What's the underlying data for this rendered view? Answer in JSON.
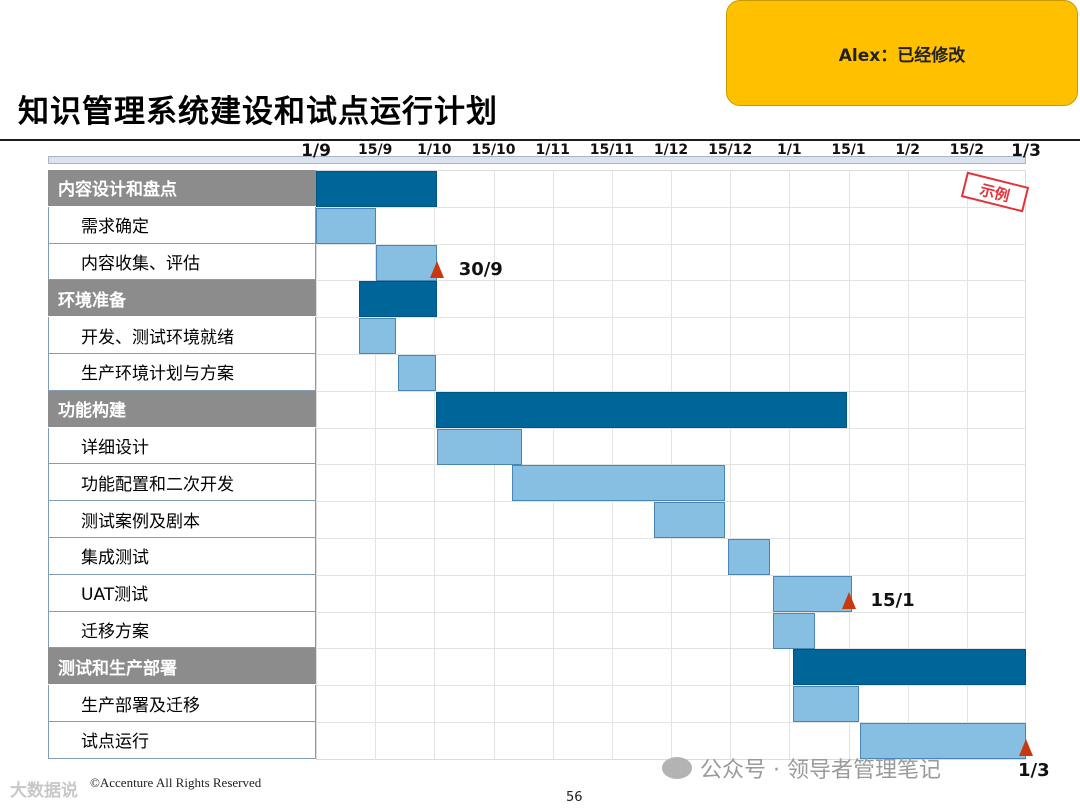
{
  "note": {
    "text": "Alex：已经修改"
  },
  "title": "知识管理系统建设和试点运行计划",
  "timeline": {
    "ticks": [
      "1/9",
      "15/9",
      "1/10",
      "15/10",
      "1/11",
      "15/11",
      "1/12",
      "15/12",
      "1/1",
      "15/1",
      "1/2",
      "15/2",
      "1/3"
    ]
  },
  "rows": [
    {
      "label": "内容设计和盘点",
      "kind": "group",
      "start": 0,
      "end": 1.02
    },
    {
      "label": "需求确定",
      "kind": "task",
      "start": 0,
      "end": 0.51
    },
    {
      "label": "内容收集、评估",
      "kind": "task",
      "start": 0.51,
      "end": 1.02
    },
    {
      "label": "环境准备",
      "kind": "group",
      "start": 0.36,
      "end": 1.02
    },
    {
      "label": "开发、测试环境就绪",
      "kind": "task",
      "start": 0.36,
      "end": 0.68
    },
    {
      "label": "生产环境计划与方案",
      "kind": "task",
      "start": 0.69,
      "end": 1.01
    },
    {
      "label": "功能构建",
      "kind": "group",
      "start": 1.01,
      "end": 4.49
    },
    {
      "label": "详细设计",
      "kind": "task",
      "start": 1.02,
      "end": 1.74
    },
    {
      "label": "功能配置和二次开发",
      "kind": "task",
      "start": 1.66,
      "end": 3.46
    },
    {
      "label": "测试案例及剧本",
      "kind": "task",
      "start": 2.86,
      "end": 3.46
    },
    {
      "label": "集成测试",
      "kind": "task",
      "start": 3.48,
      "end": 3.84
    },
    {
      "label": "UAT测试",
      "kind": "task",
      "start": 3.86,
      "end": 4.53
    },
    {
      "label": "迁移方案",
      "kind": "task",
      "start": 3.86,
      "end": 4.22
    },
    {
      "label": "测试和生产部署",
      "kind": "group",
      "start": 4.03,
      "end": 6.0
    },
    {
      "label": "生产部署及迁移",
      "kind": "task",
      "start": 4.03,
      "end": 4.59
    },
    {
      "label": "试点运行",
      "kind": "task",
      "start": 4.6,
      "end": 6.0
    }
  ],
  "milestones": [
    {
      "label": "30/9",
      "row": 2,
      "pos": 1.02
    },
    {
      "label": "15/1",
      "row": 11,
      "pos": 4.5
    },
    {
      "label": "1/3",
      "row": 15,
      "pos": 6.0
    }
  ],
  "stamp": "示例",
  "footer": {
    "copyright": "©Accenture   All Rights Reserved",
    "page": "56"
  },
  "watermark": {
    "text": "公众号 · 领导者管理笔记"
  },
  "logo": {
    "text": "大数据说"
  },
  "colors": {
    "group_bar": "#006699",
    "task_bar": "#87bfe3",
    "milestone": "#c8390f",
    "note_bg": "#FFC000"
  }
}
